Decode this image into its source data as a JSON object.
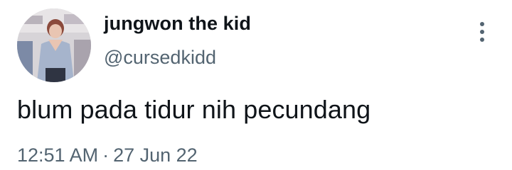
{
  "tweet": {
    "author": {
      "display_name": "jungwon the kid",
      "handle": "@cursedkidd",
      "avatar_icon": "profile-photo"
    },
    "text": "blum pada tidur nih pecundang",
    "time": "12:51 AM",
    "separator": "·",
    "date": "27 Jun 22",
    "more_icon": "more-vertical-icon"
  },
  "colors": {
    "text_primary": "#0f1419",
    "text_secondary": "#536471",
    "background": "#ffffff"
  }
}
